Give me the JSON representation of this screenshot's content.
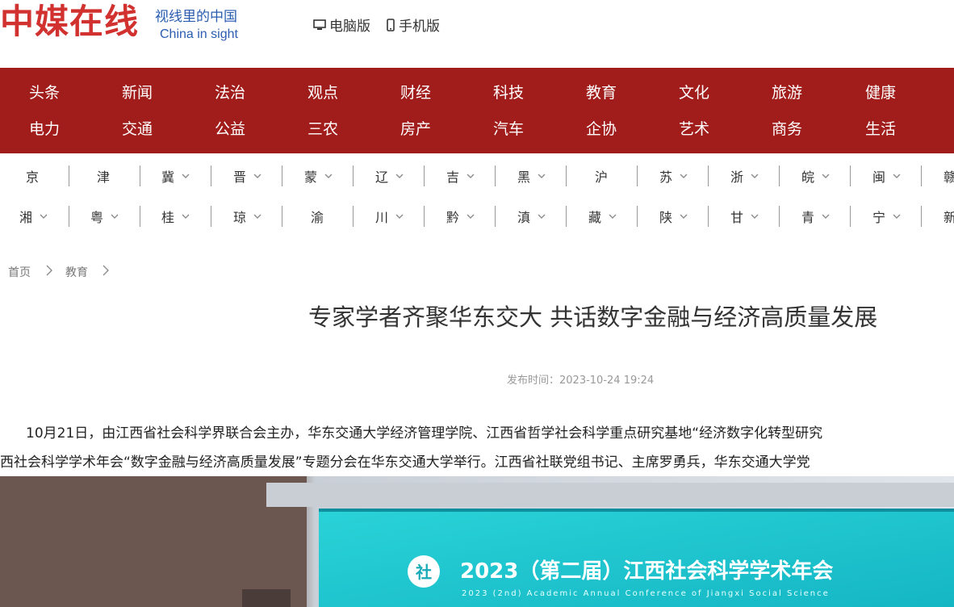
{
  "header": {
    "logo": "中媒在线",
    "slogan_cn": "视线里的中国",
    "slogan_en": "China in sight",
    "pc_label": "电脑版",
    "mobile_label": "手机版"
  },
  "nav": {
    "row1": [
      "头条",
      "新闻",
      "法治",
      "观点",
      "财经",
      "科技",
      "教育",
      "文化",
      "旅游",
      "健康"
    ],
    "row2": [
      "电力",
      "交通",
      "公益",
      "三农",
      "房产",
      "汽车",
      "企协",
      "艺术",
      "商务",
      "生活"
    ]
  },
  "provinces": {
    "row1": [
      "京",
      "津",
      "冀",
      "晋",
      "蒙",
      "辽",
      "吉",
      "黑",
      "沪",
      "苏",
      "浙",
      "皖",
      "闽",
      "赣"
    ],
    "row2": [
      "湘",
      "粤",
      "桂",
      "琼",
      "渝",
      "川",
      "黔",
      "滇",
      "藏",
      "陕",
      "甘",
      "青",
      "宁",
      "新"
    ]
  },
  "breadcrumb": [
    "首页",
    "教育"
  ],
  "article": {
    "title": "专家学者齐聚华东交大 共话数字金融与经济高质量发展",
    "publish_label": "发布时间：",
    "publish_time": "2023-10-24 19:24",
    "para_line1": "10月21日，由江西省社会科学界联合会主办，华东交通大学经济管理学院、江西省哲学社会科学重点研究基地“经济数字化转型研究",
    "para_line2": "西社会科学学术年会“数字金融与经济高质量发展”专题分会在华东交通大学举行。江西省社联党组书记、主席罗勇兵，华东交通大学党",
    "photo_banner_cn": "2023（第二届）江西社会科学学术年会",
    "photo_banner_en": "2023 (2nd) Academic Annual Conference of Jiangxi Social Science",
    "photo_logo_char": "社"
  },
  "colors": {
    "brand_red": "#d1322f",
    "nav_bg": "#a11d1b",
    "slogan_blue": "#2a5db0"
  }
}
